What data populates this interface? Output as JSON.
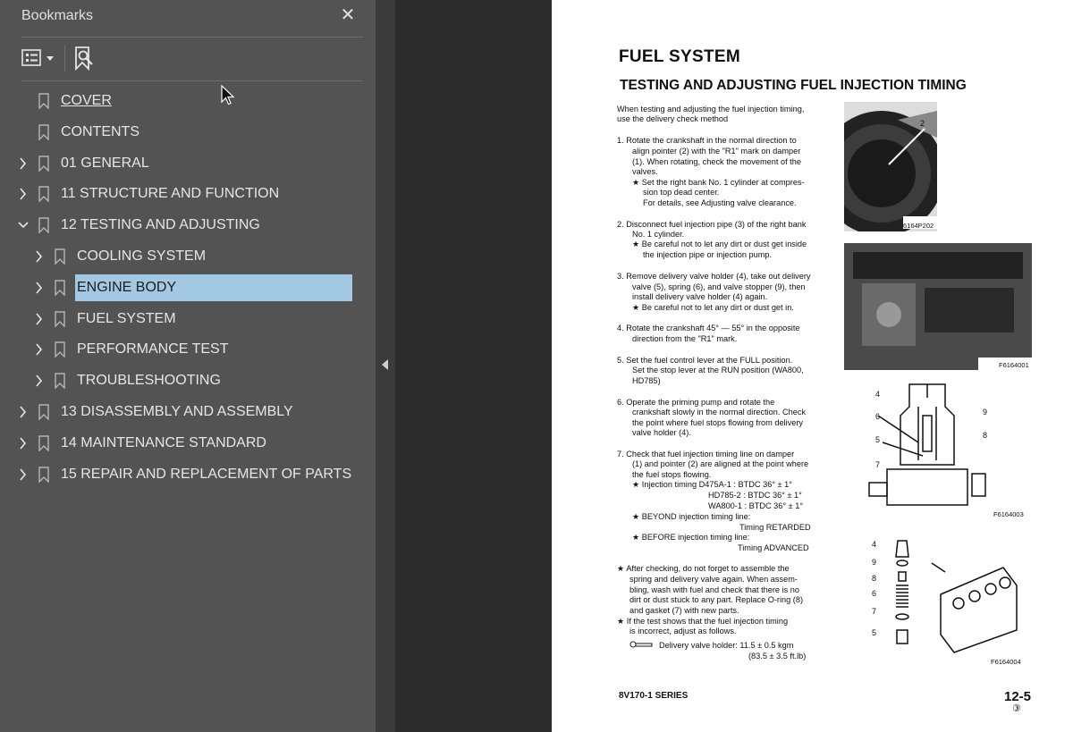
{
  "bookmarks_panel": {
    "title": "Bookmarks",
    "close_label": "✕",
    "options_icon": "list-options-icon",
    "find_icon": "find-bookmark-icon",
    "items": [
      {
        "label": "COVER",
        "level": 0,
        "expandable": false,
        "expanded": false,
        "selected": false,
        "underlined": true
      },
      {
        "label": "CONTENTS",
        "level": 0,
        "expandable": false,
        "expanded": false,
        "selected": false,
        "underlined": false
      },
      {
        "label": "01 GENERAL",
        "level": 0,
        "expandable": true,
        "expanded": false,
        "selected": false,
        "underlined": false
      },
      {
        "label": "11 STRUCTURE AND FUNCTION",
        "level": 0,
        "expandable": true,
        "expanded": false,
        "selected": false,
        "underlined": false
      },
      {
        "label": "12 TESTING AND ADJUSTING",
        "level": 0,
        "expandable": true,
        "expanded": true,
        "selected": false,
        "underlined": false
      },
      {
        "label": "COOLING SYSTEM",
        "level": 1,
        "expandable": true,
        "expanded": false,
        "selected": false,
        "underlined": false
      },
      {
        "label": "ENGINE BODY",
        "level": 1,
        "expandable": true,
        "expanded": false,
        "selected": true,
        "underlined": false
      },
      {
        "label": "FUEL SYSTEM",
        "level": 1,
        "expandable": true,
        "expanded": false,
        "selected": false,
        "underlined": false
      },
      {
        "label": "PERFORMANCE TEST",
        "level": 1,
        "expandable": true,
        "expanded": false,
        "selected": false,
        "underlined": false
      },
      {
        "label": "TROUBLESHOOTING",
        "level": 1,
        "expandable": true,
        "expanded": false,
        "selected": false,
        "underlined": false
      },
      {
        "label": "13 DISASSEMBLY AND ASSEMBLY",
        "level": 0,
        "expandable": true,
        "expanded": false,
        "selected": false,
        "underlined": false
      },
      {
        "label": "14 MAINTENANCE STANDARD",
        "level": 0,
        "expandable": true,
        "expanded": false,
        "selected": false,
        "underlined": false
      },
      {
        "label": "15 REPAIR AND REPLACEMENT OF PARTS",
        "level": 0,
        "expandable": true,
        "expanded": false,
        "selected": false,
        "underlined": false
      }
    ]
  },
  "colors": {
    "panel_bg": "#535353",
    "selected_bg": "#a3c8e3",
    "page_bg": "#ffffff",
    "viewer_bg": "#2b2b2b"
  },
  "document_page": {
    "section_title": "FUEL SYSTEM",
    "heading": "TESTING AND ADJUSTING FUEL INJECTION TIMING",
    "lines": [
      "When testing and adjusting the fuel injection timing,",
      "use the delivery check method",
      "1.   Rotate the crankshaft in the normal direction to",
      "align pointer (2) with the \"R1\" mark on damper",
      "(1). When rotating, check the movement of the",
      "valves.",
      "★ Set the right bank No. 1 cylinder at compres-",
      "sion top dead center.",
      "For details, see Adjusting valve clearance.",
      "2.   Disconnect fuel injection pipe (3) of the right bank",
      "No. 1 cylinder.",
      "★ Be careful not to let any dirt or dust get inside",
      "the injection pipe or injection pump.",
      "3.   Remove delivery valve holder (4), take out delivery",
      "valve (5), spring (6), and valve stopper (9), then",
      "install delivery valve holder (4) again.",
      "★ Be careful not to let any dirt or dust get in.",
      "4.   Rotate the crankshaft 45° — 55° in the opposite",
      "direction from the \"R1\" mark.",
      "5.   Set the fuel control lever at the FULL position.",
      "Set the stop lever at the RUN position (WA800,",
      "HD785)",
      "6.   Operate the priming pump and rotate the",
      "crankshaft slowly in the normal direction. Check",
      "the point where fuel stops flowing from delivery",
      "valve holder (4).",
      "7.   Check that fuel injection timing line on damper",
      "(1) and pointer (2) are aligned at the point where",
      "the fuel stops flowing.",
      "★ Injection timing   D475A-1  : BTDC 36° ± 1°",
      "HD785-2  : BTDC 36° ± 1°",
      "WA800-1 : BTDC 36° ± 1°",
      "★ BEYOND injection timing line:",
      "Timing RETARDED",
      "★ BEFORE injection timing line:",
      "Timing ADVANCED",
      "★   After checking, do not forget to assemble the",
      "spring and delivery valve again. When assem-",
      "bling, wash with fuel and check that there is no",
      "dirt or dust stuck to any part. Replace O-ring (8)",
      "and gasket (7) with new parts.",
      "★   If the test shows that the fuel injection timing",
      "is incorrect, adjust as follows.",
      "Delivery valve holder: 11.5 ± 0.5 kgm",
      "(83.5 ± 3.5 ft.lb)"
    ],
    "figure_labels": [
      "6164P202",
      "F6164001",
      "F6164003",
      "F6164004"
    ],
    "callouts": [
      "2",
      "4",
      "6",
      "5",
      "7",
      "9",
      "8",
      "4",
      "9",
      "8",
      "6",
      "7",
      "5"
    ],
    "footer_series": "8V170-1 SERIES",
    "page_number": "12-5",
    "revision_mark": "③",
    "torque_icon": "torque-wrench-icon"
  }
}
